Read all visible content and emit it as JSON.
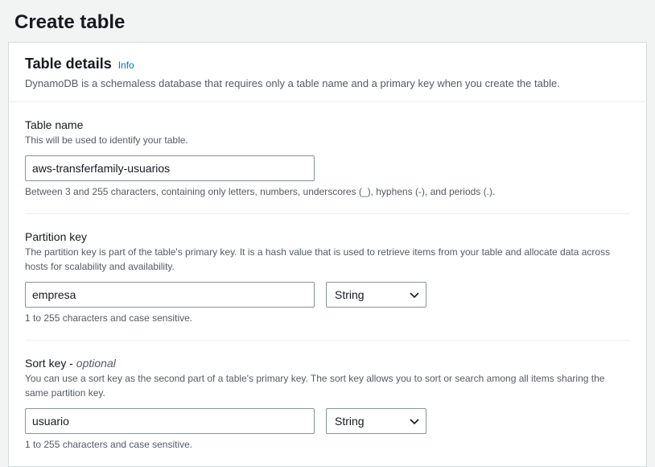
{
  "page": {
    "title": "Create table"
  },
  "panel": {
    "title": "Table details",
    "info_label": "Info",
    "description": "DynamoDB is a schemaless database that requires only a table name and a primary key when you create the table."
  },
  "table_name": {
    "label": "Table name",
    "help": "This will be used to identify your table.",
    "value": "aws-transferfamily-usuarios",
    "constraint": "Between 3 and 255 characters, containing only letters, numbers, underscores (_), hyphens (-), and periods (.)."
  },
  "partition_key": {
    "label": "Partition key",
    "help": "The partition key is part of the table's primary key. It is a hash value that is used to retrieve items from your table and allocate data across hosts for scalability and availability.",
    "value": "empresa",
    "type_value": "String",
    "constraint": "1 to 255 characters and case sensitive."
  },
  "sort_key": {
    "label": "Sort key - ",
    "optional_label": "optional",
    "help": "You can use a sort key as the second part of a table's primary key. The sort key allows you to sort or search among all items sharing the same partition key.",
    "value": "usuario",
    "type_value": "String",
    "constraint": "1 to 255 characters and case sensitive."
  }
}
